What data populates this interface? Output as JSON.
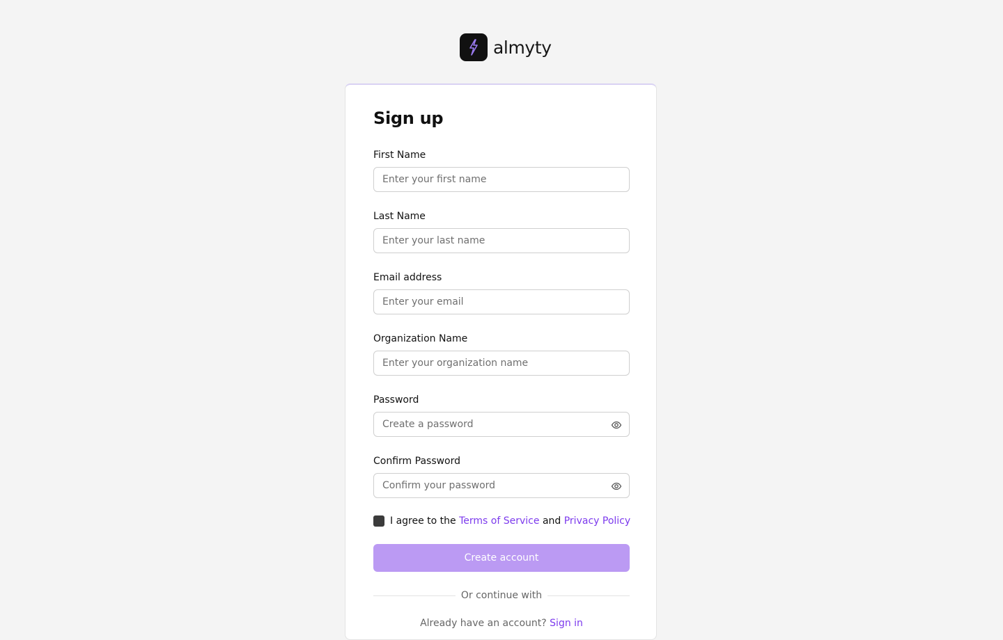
{
  "brand": {
    "name": "almyty",
    "logo_icon": "lightning-bolt-icon",
    "logo_bg": "#111111",
    "logo_accent": "#9b7bf0"
  },
  "form": {
    "title": "Sign up",
    "fields": [
      {
        "label": "First Name",
        "placeholder": "Enter your first name",
        "value": ""
      },
      {
        "label": "Last Name",
        "placeholder": "Enter your last name",
        "value": ""
      },
      {
        "label": "Email address",
        "placeholder": "Enter your email",
        "value": ""
      },
      {
        "label": "Organization Name",
        "placeholder": "Enter your organization name",
        "value": ""
      },
      {
        "label": "Password",
        "placeholder": "Create a password",
        "value": "",
        "icon": "eye-icon"
      },
      {
        "label": "Confirm Password",
        "placeholder": "Confirm your password",
        "value": "",
        "icon": "eye-icon"
      }
    ],
    "agree": {
      "prefix": "I agree to the",
      "terms_link": "Terms of Service",
      "joiner": "and",
      "privacy_link": "Privacy Policy",
      "checked": false
    },
    "submit_label": "Create account",
    "divider_text": "Or continue with",
    "signin_prompt": "Already have an account?",
    "signin_link": "Sign in"
  },
  "colors": {
    "accent": "#7c3aed",
    "button_disabled": "#bb9af3",
    "page_bg": "#f4f4f4"
  }
}
